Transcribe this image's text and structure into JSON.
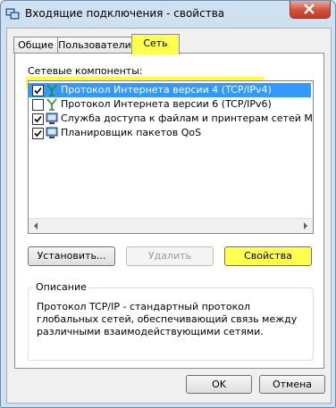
{
  "window": {
    "title": "Входящие подключения - свойства"
  },
  "tabs": [
    {
      "label": "Общие",
      "active": false
    },
    {
      "label": "Пользователи",
      "active": false
    },
    {
      "label": "Сеть",
      "active": true
    }
  ],
  "network": {
    "components_label": "Сетевые компоненты:",
    "items": [
      {
        "label": "Протокол Интернета версии 4 (TCP/IPv4)",
        "checked": true,
        "selected": true,
        "icon": "network-protocol-icon"
      },
      {
        "label": "Протокол Интернета версии 6 (TCP/IPv6)",
        "checked": false,
        "selected": false,
        "icon": "network-protocol-icon"
      },
      {
        "label": "Служба доступа к файлам и принтерам сетей Microsoft",
        "checked": true,
        "selected": false,
        "icon": "network-service-icon"
      },
      {
        "label": "Планировщик пакетов QoS",
        "checked": true,
        "selected": false,
        "icon": "network-service-icon"
      }
    ],
    "buttons": {
      "install": "Установить...",
      "remove": "Удалить",
      "properties": "Свойства"
    },
    "description_title": "Описание",
    "description": "Протокол TCP/IP - стандартный протокол глобальных сетей, обеспечивающий связь между различными взаимодействующими сетями."
  },
  "footer": {
    "ok": "OK",
    "cancel": "Отмена"
  },
  "colors": {
    "selection": "#3399ff",
    "highlighter": "#ffff4d",
    "titlebar": "#cfe0f1",
    "close": "#c4391f"
  }
}
